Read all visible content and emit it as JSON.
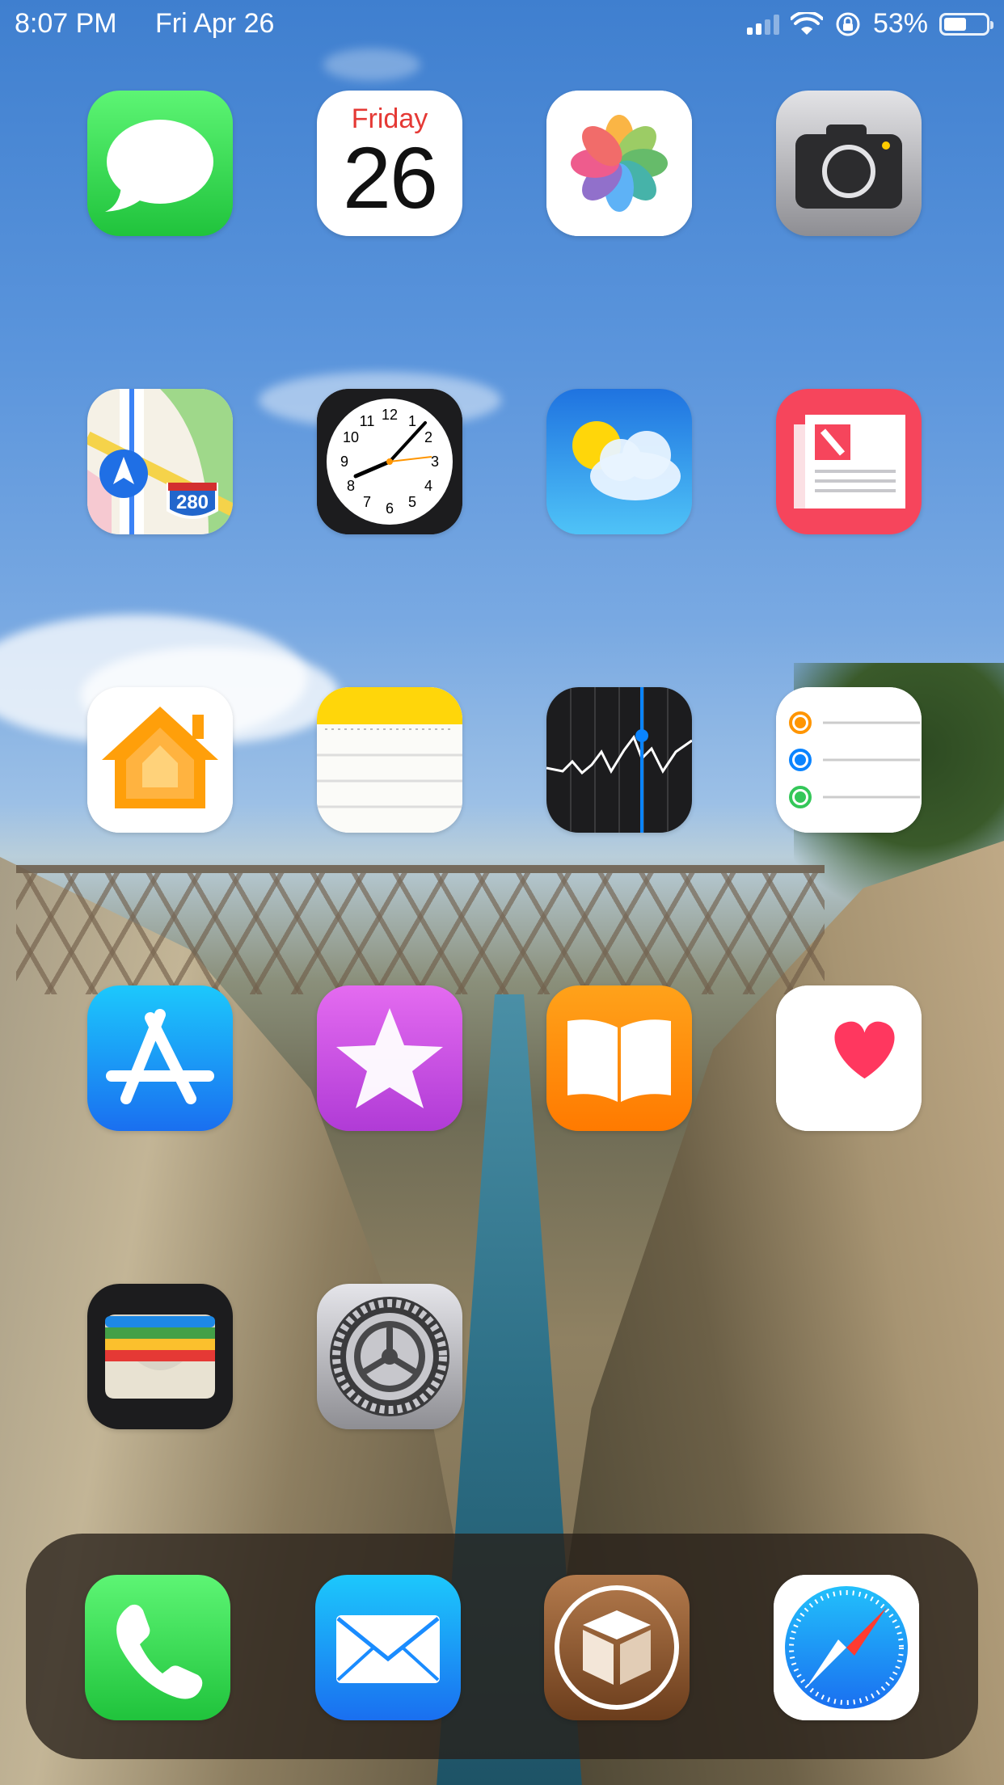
{
  "status_bar": {
    "time": "8:07 PM",
    "date": "Fri Apr 26",
    "battery": "53%",
    "battery_level": 0.53
  },
  "calendar": {
    "weekday": "Friday",
    "day": "26"
  },
  "maps": {
    "route_shield": "280"
  },
  "clock": {
    "numerals": [
      "12",
      "1",
      "2",
      "3",
      "4",
      "5",
      "6",
      "7",
      "8",
      "9",
      "10",
      "11"
    ],
    "time_shown": "8:07"
  },
  "apps": [
    {
      "id": "messages",
      "icon": "messages-icon"
    },
    {
      "id": "calendar",
      "icon": "calendar-icon"
    },
    {
      "id": "photos",
      "icon": "photos-icon"
    },
    {
      "id": "camera",
      "icon": "camera-icon"
    },
    {
      "id": "maps",
      "icon": "maps-icon"
    },
    {
      "id": "clock",
      "icon": "clock-icon"
    },
    {
      "id": "weather",
      "icon": "weather-icon"
    },
    {
      "id": "news",
      "icon": "news-icon"
    },
    {
      "id": "home",
      "icon": "home-icon"
    },
    {
      "id": "notes",
      "icon": "notes-icon"
    },
    {
      "id": "stocks",
      "icon": "stocks-icon"
    },
    {
      "id": "reminders",
      "icon": "reminders-icon"
    },
    {
      "id": "app-store",
      "icon": "app-store-icon"
    },
    {
      "id": "itunes-store",
      "icon": "star-icon"
    },
    {
      "id": "books",
      "icon": "book-icon"
    },
    {
      "id": "health",
      "icon": "heart-icon"
    },
    {
      "id": "wallet",
      "icon": "wallet-icon"
    },
    {
      "id": "settings",
      "icon": "gear-icon"
    }
  ],
  "dock": [
    {
      "id": "phone",
      "icon": "phone-icon"
    },
    {
      "id": "mail",
      "icon": "envelope-icon"
    },
    {
      "id": "cydia",
      "icon": "box-icon"
    },
    {
      "id": "safari",
      "icon": "compass-icon"
    }
  ],
  "colors": {
    "messages_green": "#34c759",
    "calendar_red": "#e53935",
    "news_red": "#f6455c",
    "appstore_blue": "#1a8cff",
    "books_orange": "#ff8a00",
    "itunes_purple": "#c24be0"
  }
}
